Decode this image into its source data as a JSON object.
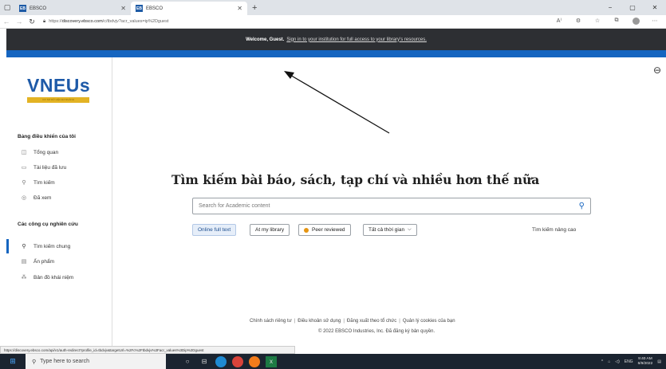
{
  "browser": {
    "tabs": [
      {
        "label": "EBSCO",
        "favicon": "EB",
        "active": false
      },
      {
        "label": "EBSCO",
        "favicon": "EB",
        "active": true
      }
    ],
    "new_tab": "+",
    "url_prefix": "https://",
    "url_domain": "discovery.ebsco.com",
    "url_path": "/c/tbdvjv?acr_values=ip%2Dguest",
    "window_controls": [
      "−",
      "▢",
      "✕"
    ]
  },
  "banner": {
    "welcome": "Welcome, Guest.",
    "message": "Sign in to your institution for full access to your library's resources."
  },
  "sidebar": {
    "logo": "VNEUs",
    "logo_sub": "CƠ SỞ DỮ LIỆU ĐA NGÀNH",
    "section1": "Bảng điều khiển của tôi",
    "items1": [
      {
        "label": "Tổng quan",
        "icon": "overview-icon"
      },
      {
        "label": "Tài liệu đã lưu",
        "icon": "bookmark-icon"
      },
      {
        "label": "Tìm kiếm",
        "icon": "search-icon"
      },
      {
        "label": "Đã xem",
        "icon": "eye-icon"
      }
    ],
    "section2": "Các công cụ nghiên cứu",
    "items2": [
      {
        "label": "Tìm kiếm chung",
        "icon": "search-icon",
        "active": true
      },
      {
        "label": "Ấn phẩm",
        "icon": "publication-icon"
      },
      {
        "label": "Bản đồ khái niệm",
        "icon": "concept-map-icon"
      }
    ]
  },
  "main": {
    "heading": "Tìm kiếm bài báo, sách, tạp chí và nhiều hơn thế nữa",
    "search_placeholder": "Search for Academic content",
    "filters": {
      "online_full_text": "Online full text",
      "at_my_library": "At my library",
      "peer_reviewed": "Peer reviewed",
      "all_time": "Tất cả thời gian"
    },
    "advanced_search": "Tìm kiếm nâng cao"
  },
  "footer": {
    "links": [
      "Chính sách riêng tư",
      "Điều khoản sử dụng",
      "Đăng xuất theo tổ chức",
      "Quản lý cookies của bạn"
    ],
    "copyright": "© 2022 EBSCO Industries, Inc. Đã đăng ký bản quyền."
  },
  "status_url": "https://discovery.ebsco.com/api/v1/auth-redirect?profile_id=tbdvjv&targetUrl=%2Fc%2Ftbdvjv%3Facr_values%3Dip%2Dguest",
  "taskbar": {
    "search_placeholder": "Type here to search",
    "lang": "ENG",
    "time": "9:40 AM",
    "date": "6/9/2022"
  },
  "colors": {
    "accent": "#1565c0",
    "banner": "#2d2f33",
    "logo": "#1e5aa8"
  }
}
